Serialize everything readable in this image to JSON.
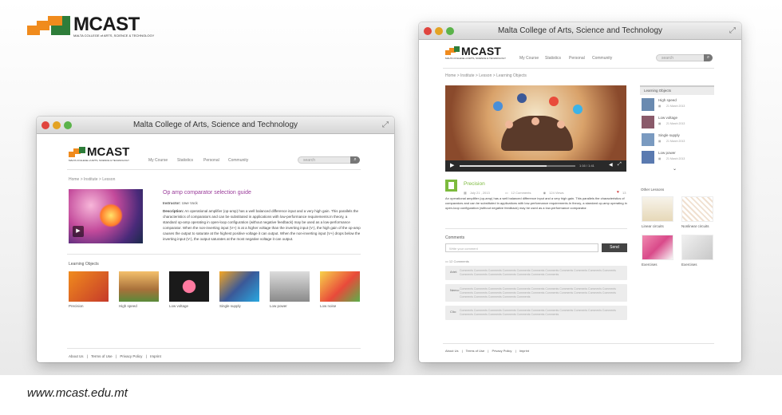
{
  "brand": {
    "name": "MCAST",
    "tagline": "MALTA COLLEGE of ARTS, SCIENCE & TECHNOLOGY",
    "orange": "#f08b1d",
    "green": "#2e7d3a",
    "url": "www.mcast.edu.mt"
  },
  "left": {
    "title": "Malta College of Arts, Science and Technology",
    "logo": "MCAST",
    "logo_tag": "MALTA COLLEGE of ARTS, SCIENCE & TECHNOLOGY",
    "nav": [
      "My Course",
      "Statistics",
      "Personal",
      "Community"
    ],
    "search_placeholder": "search",
    "breadcrumb": "Home  >  Institute  >  Lesson",
    "lesson_title": "Op amp comparator selection guide",
    "instructor_label": "Instructor:",
    "instructor": "Uwe Vock",
    "description_label": "Description:",
    "description": "An operational amplifier (op-amp) has a well balanced difference input and a very high gain. This parallels the characteristics of comparators and can be substituted in applications with low-performance requirements.In theory, a standard op-amp operating in open-loop configuration (without negative feedback) may be used as a low-performance comparator. When the non-inverting input (V+) is at a higher voltage than the inverting input (V-), the high gain of the op-amp causes the output to saturate at the highest positive voltage it can output. When the non-inverting input (V+) drops below the inverting input (V-), the output saturates at the most negative voltage it can output.",
    "objects_heading": "Learning Objects",
    "objects": [
      "Precision",
      "High speed",
      "Low voltage",
      "Single supply",
      "Low power",
      "Low noise"
    ],
    "footer": [
      "About Us",
      "|",
      "Terms of Use",
      "|",
      "Privacy Policy",
      "|",
      "Imprint"
    ]
  },
  "right": {
    "title": "Malta College of Arts, Science and Technology",
    "logo": "MCAST",
    "logo_tag": "MALTA COLLEGE of ARTS, SCIENCE & TECHNOLOGY",
    "nav": [
      "My Course",
      "Statistics",
      "Personal",
      "Community"
    ],
    "search_placeholder": "search",
    "breadcrumb": "Home  >  Institute  >  Lesson  >  Learning Objects",
    "video_time": "1:16 / 1:41",
    "item_title": "Precision",
    "date": "July 21 , 2013",
    "comments_count": "12 Comments",
    "views": "124 Views",
    "likes": "13",
    "description": "An operational amplifier (op-amp) has a well balanced difference input and a very high gain. This parallels the characteristics of comparators and can be substituted in applications with low-performance requirements.In theory, a standard op-amp operating in open-loop configuration (without negative feedback) may be used as a low-performance comparator.",
    "comments_heading": "Comments",
    "comment_placeholder": "Write your comment",
    "send_label": "Send",
    "comments_total": "12 Comments",
    "comments": [
      {
        "author": "Ariel:",
        "text": "Comments Comments Comments Comments Comments Comments Comments Comments Comments Comments Comments Comments Comments Comments Comments Comments Comments Comments"
      },
      {
        "author": "Nemo:",
        "text": "Comments Comments Comments Comments Comments Comments Comments Comments Comments Comments Comments Comments Comments Comments Comments Comments Comments Comments Comments Comments Comments Comments Comments Comments Comments Comments Comments"
      },
      {
        "author": "Clio:",
        "text": "Comments Comments Comments Comments Comments Comments Comments Comments Comments Comments Comments Comments Comments Comments Comments Comments Comments Comments"
      }
    ],
    "objects_heading": "Learning Objects",
    "objects": [
      {
        "name": "High speed",
        "date": "21 March 2013"
      },
      {
        "name": "Low voltage",
        "date": "21 March 2013"
      },
      {
        "name": "Single supply",
        "date": "21 March 2013"
      },
      {
        "name": "Low power",
        "date": "21 March 2013"
      }
    ],
    "other_heading": "Other Lessons",
    "other": [
      "Linear circuits",
      "Nonlinear circuits",
      "Exercises",
      "Exercises"
    ],
    "footer": [
      "About Us",
      "|",
      "Terms of Use",
      "|",
      "Privacy Policy",
      "|",
      "Imprint"
    ]
  }
}
